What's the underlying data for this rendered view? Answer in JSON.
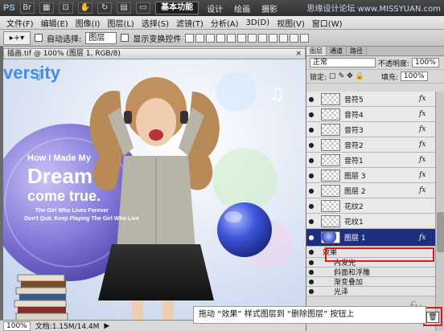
{
  "titlebar": {
    "logo": "PS",
    "workspace_active": "基本功能",
    "workspaces": [
      "设计",
      "绘画",
      "摄影"
    ],
    "watermark": "思缘设计论坛 www.MISSYUAN.com"
  },
  "menu": [
    "文件(F)",
    "编辑(E)",
    "图像(I)",
    "图层(L)",
    "选择(S)",
    "滤镜(T)",
    "分析(A)",
    "3D(D)",
    "视图(V)",
    "窗口(W)"
  ],
  "options": {
    "auto_select_label": "自动选择:",
    "auto_select_value": "图层",
    "show_transform_label": "显示变换控件"
  },
  "document": {
    "tab_title": "插画.tif @ 100% (图层 1, RGB/8)",
    "close": "×"
  },
  "canvas_texts": {
    "brand": "versity",
    "headline1": "How I Made My",
    "headline2": "Dream",
    "headline3": "come true.",
    "line1": "The Girl Who Lives Forever",
    "line2": "Don't Quit. Keep Playing The Girl Who Live"
  },
  "status": {
    "zoom": "100%",
    "doc": "文档:1.15M/14.4M"
  },
  "panel": {
    "tabs": [
      "图层",
      "通道",
      "路径"
    ],
    "blend_mode": "正常",
    "opacity_label": "不透明度:",
    "opacity": "100%",
    "lock_label": "锁定:",
    "fill_label": "填充:",
    "fill": "100%",
    "fx_label": "fx",
    "layers": [
      {
        "name": "音符5",
        "fx": true
      },
      {
        "name": "音符4",
        "fx": true
      },
      {
        "name": "音符3",
        "fx": true
      },
      {
        "name": "音符2",
        "fx": true
      },
      {
        "name": "音符1",
        "fx": true
      },
      {
        "name": "图层 3",
        "fx": true
      },
      {
        "name": "图层 2",
        "fx": true
      },
      {
        "name": "花纹2",
        "fx": false
      },
      {
        "name": "花纹1",
        "fx": false
      },
      {
        "name": "图层 1",
        "fx": true,
        "selected": true
      }
    ],
    "effects_label": "效果",
    "effects": [
      "内发光",
      "斜面和浮雕",
      "渐变叠加",
      "光泽"
    ]
  },
  "caption": "拖动 “效果” 样式图层到 “删除图层” 按钮上",
  "colors": {
    "highlight": "#e01818",
    "selected_layer": "#1f2f80"
  }
}
